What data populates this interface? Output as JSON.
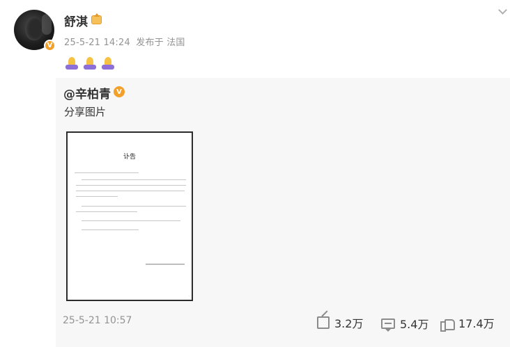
{
  "author": {
    "name": "舒淇",
    "avatar_icon": "avatar-photo",
    "verified_icon": "verified-badge-icon",
    "vip_icon": "crown-icon"
  },
  "post": {
    "time": "25-5-21 14:24",
    "source": "发布于 法国",
    "emojis": [
      "pray-icon",
      "pray-icon",
      "pray-icon"
    ]
  },
  "repost": {
    "author": "@辛柏青",
    "text": "分享图片",
    "image_title": "讣告",
    "time": "25-5-21 10:57",
    "stats": {
      "share_count": "3.2万",
      "comment_count": "5.4万",
      "like_count": "17.4万"
    }
  },
  "colors": {
    "badge": "#f3a02b",
    "meta_text": "#939393",
    "repost_bg": "#f7f7f7",
    "emoji_purple": "#8e6fd8"
  }
}
